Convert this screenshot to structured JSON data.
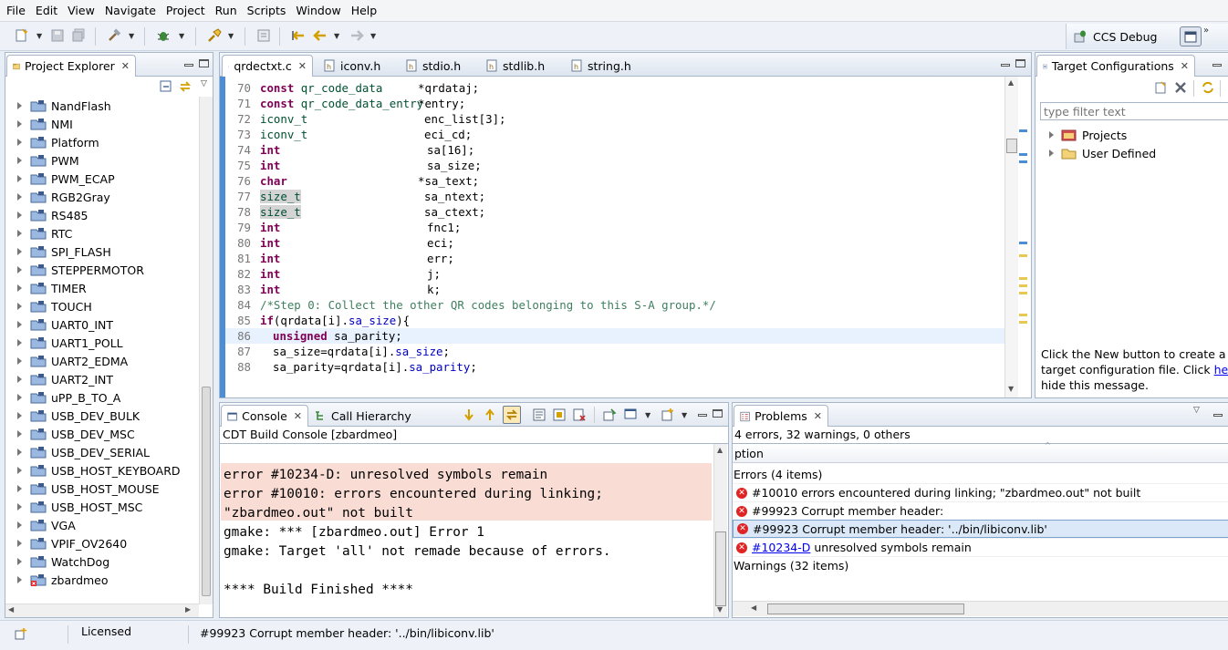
{
  "menu": [
    "File",
    "Edit",
    "View",
    "Navigate",
    "Project",
    "Run",
    "Scripts",
    "Window",
    "Help"
  ],
  "perspective": {
    "label": "CCS Debug"
  },
  "project_explorer": {
    "title": "Project Explorer",
    "items": [
      "NandFlash",
      "NMI",
      "Platform",
      "PWM",
      "PWM_ECAP",
      "RGB2Gray",
      "RS485",
      "RTC",
      "SPI_FLASH",
      "STEPPERMOTOR",
      "TIMER",
      "TOUCH",
      "UART0_INT",
      "UART1_POLL",
      "UART2_EDMA",
      "UART2_INT",
      "uPP_B_TO_A",
      "USB_DEV_BULK",
      "USB_DEV_MSC",
      "USB_DEV_SERIAL",
      "USB_HOST_KEYBOARD",
      "USB_HOST_MOUSE",
      "USB_HOST_MSC",
      "VGA",
      "VPIF_OV2640",
      "WatchDog",
      "zbardmeo"
    ]
  },
  "editor": {
    "tabs": [
      "qrdectxt.c",
      "iconv.h",
      "stdio.h",
      "stdlib.h",
      "string.h"
    ],
    "lines": [
      {
        "n": "70",
        "type": "const qr_code_data",
        "kwpre": "const",
        "tname": "qr_code_data",
        "var": "*qrdataj;"
      },
      {
        "n": "71",
        "kwpre": "const",
        "tname": "qr_code_data_entry",
        "var": "*entry;"
      },
      {
        "n": "72",
        "tname": "iconv_t",
        "var": "enc_list[3];"
      },
      {
        "n": "73",
        "tname": "iconv_t",
        "var": "eci_cd;"
      },
      {
        "n": "74",
        "kw": "int",
        "var": "sa[16];"
      },
      {
        "n": "75",
        "kw": "int",
        "var": "sa_size;"
      },
      {
        "n": "76",
        "kw": "char",
        "var": "*sa_text;"
      },
      {
        "n": "77",
        "tname": "size_t",
        "var": "sa_ntext;"
      },
      {
        "n": "78",
        "tname": "size_t",
        "var": "sa_ctext;"
      },
      {
        "n": "79",
        "kw": "int",
        "var": "fnc1;"
      },
      {
        "n": "80",
        "kw": "int",
        "var": "eci;"
      },
      {
        "n": "81",
        "kw": "int",
        "var": "err;"
      },
      {
        "n": "82",
        "kw": "int",
        "var": "j;"
      },
      {
        "n": "83",
        "kw": "int",
        "var": "k;"
      },
      {
        "n": "84",
        "comment": "/*Step 0: Collect the other QR codes belonging to this S-A group.*/"
      },
      {
        "n": "85",
        "kw": "if",
        "rest1": "(qrdata[i].",
        "field": "sa_size",
        "rest2": "){"
      },
      {
        "n": "86",
        "kw": "unsigned",
        "rest1": " sa_parity;"
      },
      {
        "n": "87",
        "rest1": "sa_size=qrdata[i].",
        "field": "sa_size",
        "rest2": ";"
      },
      {
        "n": "88",
        "rest1": "sa_parity=qrdata[i].",
        "field": "sa_parity",
        "rest2": ";"
      }
    ]
  },
  "target_config": {
    "title": "Target Configurations",
    "filter_placeholder": "type filter text",
    "items": [
      "Projects",
      "User Defined"
    ],
    "hint_pre": "Click the New button to create a new target configuration file. Click ",
    "hint_link": "here",
    "hint_post": " to hide this message."
  },
  "console": {
    "tabs": [
      "Console",
      "Call Hierarchy"
    ],
    "subtitle": "CDT Build Console [zbardmeo]",
    "error_lines": [
      "error #10234-D: unresolved symbols remain",
      "error #10010: errors encountered during linking;",
      "\"zbardmeo.out\" not built"
    ],
    "lines": [
      "gmake: *** [zbardmeo.out] Error 1",
      "gmake: Target 'all' not remade because of errors.",
      "",
      "**** Build Finished ****"
    ]
  },
  "problems": {
    "title": "Problems",
    "summary": "4 errors, 32 warnings, 0 others",
    "column": "ption",
    "errors_group": "Errors (4 items)",
    "errors": [
      {
        "text": "#10010 errors encountered during linking; \"zbardmeo.out\" not built"
      },
      {
        "text": "#99923 Corrupt member header:"
      },
      {
        "text": "#99923 Corrupt member header: '../bin/libiconv.lib'"
      },
      {
        "link": "#10234-D",
        "text": " unresolved symbols remain"
      }
    ],
    "warnings_group": "Warnings (32 items)"
  },
  "status": {
    "license": "Licensed",
    "message": "#99923 Corrupt member header: '../bin/libiconv.lib'"
  }
}
